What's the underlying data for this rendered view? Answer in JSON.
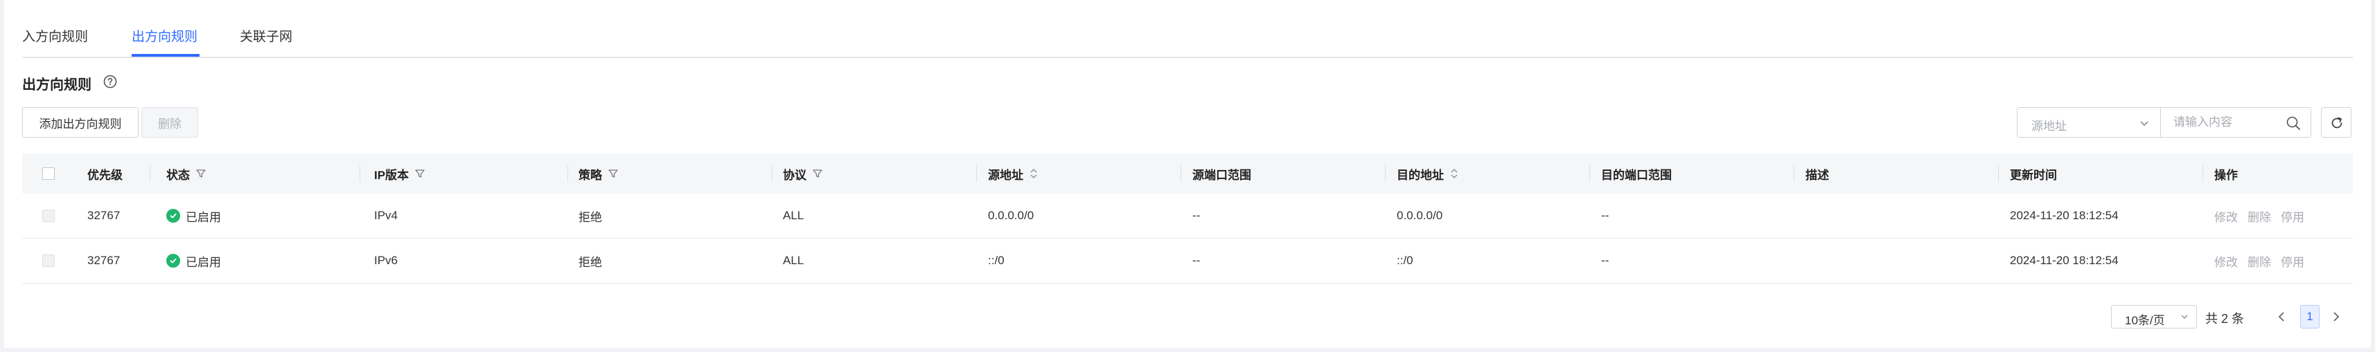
{
  "tabs": [
    {
      "label": "入方向规则"
    },
    {
      "label": "出方向规则",
      "active": true
    },
    {
      "label": "关联子网"
    }
  ],
  "section": {
    "title": "出方向规则"
  },
  "toolbar": {
    "add_label": "添加出方向规则",
    "delete_label": "删除",
    "filter_select_placeholder": "源地址",
    "search_placeholder": "请输入内容"
  },
  "table": {
    "headers": {
      "priority": "优先级",
      "status": "状态",
      "ip_version": "IP版本",
      "policy": "策略",
      "protocol": "协议",
      "src_addr": "源地址",
      "src_port": "源端口范围",
      "dst_addr": "目的地址",
      "dst_port": "目的端口范围",
      "desc": "描述",
      "updated": "更新时间",
      "actions": "操作"
    },
    "rows": [
      {
        "priority": "32767",
        "status": "已启用",
        "ip_version": "IPv4",
        "policy": "拒绝",
        "protocol": "ALL",
        "src_addr": "0.0.0.0/0",
        "src_port": "--",
        "dst_addr": "0.0.0.0/0",
        "dst_port": "--",
        "desc": "",
        "updated": "2024-11-20 18:12:54"
      },
      {
        "priority": "32767",
        "status": "已启用",
        "ip_version": "IPv6",
        "policy": "拒绝",
        "protocol": "ALL",
        "src_addr": "::/0",
        "src_port": "--",
        "dst_addr": "::/0",
        "dst_port": "--",
        "desc": "",
        "updated": "2024-11-20 18:12:54"
      }
    ],
    "row_actions": {
      "edit": "修改",
      "delete": "删除",
      "disable": "停用"
    }
  },
  "pagination": {
    "page_size": "10条/页",
    "total": "共 2 条",
    "current_page": "1"
  },
  "colors": {
    "accent": "#2f6bff",
    "status_enabled": "#21b66d",
    "muted_text": "#a8abb2"
  }
}
